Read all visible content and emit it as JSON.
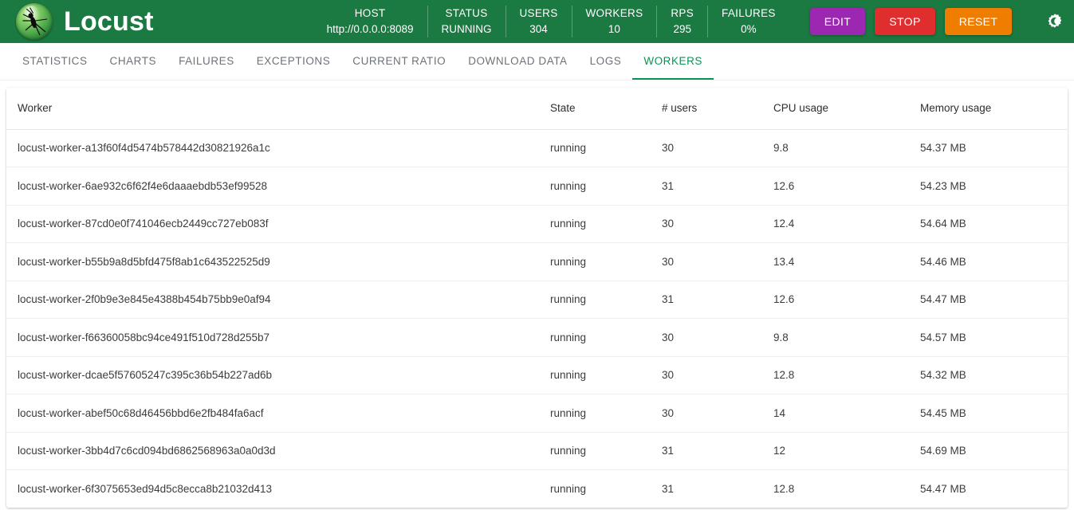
{
  "header": {
    "brand_title": "Locust",
    "logo_icon": "locust-logo-icon",
    "stats": [
      {
        "label": "HOST",
        "value": "http://0.0.0.0:8089"
      },
      {
        "label": "STATUS",
        "value": "RUNNING"
      },
      {
        "label": "USERS",
        "value": "304"
      },
      {
        "label": "WORKERS",
        "value": "10"
      },
      {
        "label": "RPS",
        "value": "295"
      },
      {
        "label": "FAILURES",
        "value": "0%"
      }
    ],
    "buttons": {
      "edit": {
        "label": "EDIT",
        "color": "#9c27b0"
      },
      "stop": {
        "label": "STOP",
        "color": "#e02d2d"
      },
      "reset": {
        "label": "RESET",
        "color": "#ef7d00"
      }
    },
    "theme_toggle_icon": "sun-moon-icon",
    "background_color": "#1a7a41"
  },
  "tabs": {
    "active_index": 7,
    "accent_color": "#0a9254",
    "items": [
      {
        "label": "STATISTICS"
      },
      {
        "label": "CHARTS"
      },
      {
        "label": "FAILURES"
      },
      {
        "label": "EXCEPTIONS"
      },
      {
        "label": "CURRENT RATIO"
      },
      {
        "label": "DOWNLOAD DATA"
      },
      {
        "label": "LOGS"
      },
      {
        "label": "WORKERS"
      }
    ]
  },
  "workers_table": {
    "columns": [
      "Worker",
      "State",
      "# users",
      "CPU usage",
      "Memory usage"
    ],
    "rows": [
      {
        "worker": "locust-worker-a13f60f4d5474b578442d30821926a1c",
        "state": "running",
        "users": "30",
        "cpu": "9.8",
        "memory": "54.37 MB"
      },
      {
        "worker": "locust-worker-6ae932c6f62f4e6daaaebdb53ef99528",
        "state": "running",
        "users": "31",
        "cpu": "12.6",
        "memory": "54.23 MB"
      },
      {
        "worker": "locust-worker-87cd0e0f741046ecb2449cc727eb083f",
        "state": "running",
        "users": "30",
        "cpu": "12.4",
        "memory": "54.64 MB"
      },
      {
        "worker": "locust-worker-b55b9a8d5bfd475f8ab1c643522525d9",
        "state": "running",
        "users": "30",
        "cpu": "13.4",
        "memory": "54.46 MB"
      },
      {
        "worker": "locust-worker-2f0b9e3e845e4388b454b75bb9e0af94",
        "state": "running",
        "users": "31",
        "cpu": "12.6",
        "memory": "54.47 MB"
      },
      {
        "worker": "locust-worker-f66360058bc94ce491f510d728d255b7",
        "state": "running",
        "users": "30",
        "cpu": "9.8",
        "memory": "54.57 MB"
      },
      {
        "worker": "locust-worker-dcae5f57605247c395c36b54b227ad6b",
        "state": "running",
        "users": "30",
        "cpu": "12.8",
        "memory": "54.32 MB"
      },
      {
        "worker": "locust-worker-abef50c68d46456bbd6e2fb484fa6acf",
        "state": "running",
        "users": "30",
        "cpu": "14",
        "memory": "54.45 MB"
      },
      {
        "worker": "locust-worker-3bb4d7c6cd094bd6862568963a0a0d3d",
        "state": "running",
        "users": "31",
        "cpu": "12",
        "memory": "54.69 MB"
      },
      {
        "worker": "locust-worker-6f3075653ed94d5c8ecca8b21032d413",
        "state": "running",
        "users": "31",
        "cpu": "12.8",
        "memory": "54.47 MB"
      }
    ]
  }
}
